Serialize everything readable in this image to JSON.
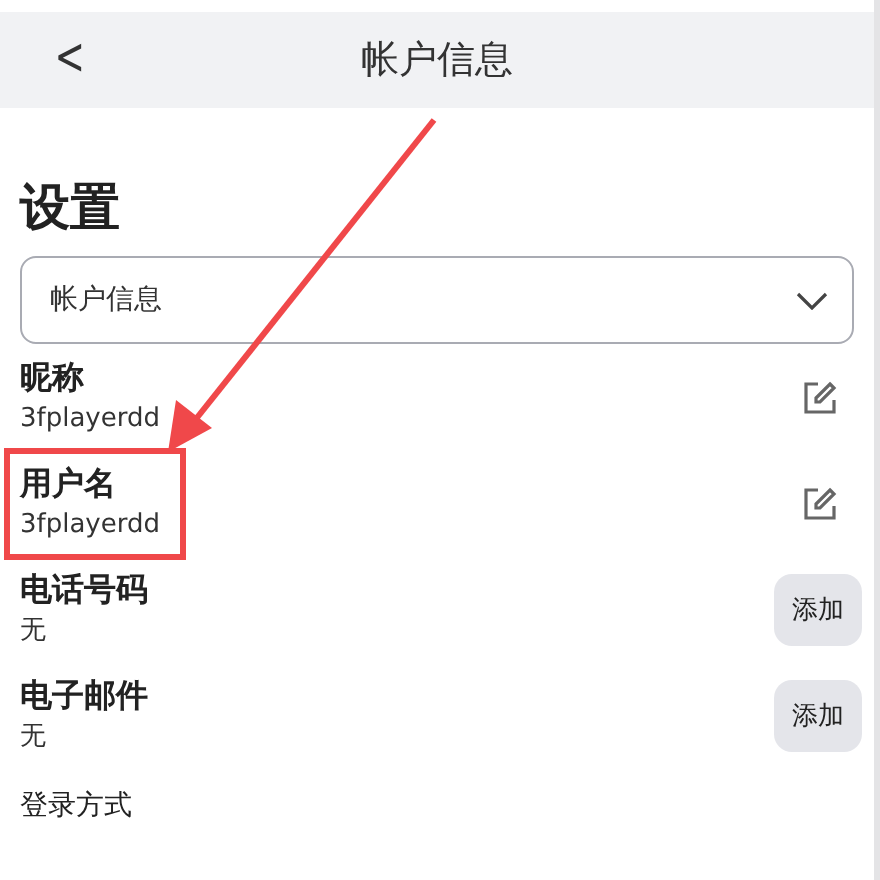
{
  "header": {
    "back": "<",
    "title": "帐户信息"
  },
  "section_title": "设置",
  "dropdown": {
    "value": "帐户信息"
  },
  "fields": [
    {
      "label": "昵称",
      "value": "3fplayerdd",
      "kind": "edit",
      "highlighted": false
    },
    {
      "label": "用户名",
      "value": "3fplayerdd",
      "kind": "edit",
      "highlighted": true
    },
    {
      "label": "电话号码",
      "value": "无",
      "kind": "add",
      "action": "添加",
      "highlighted": false
    },
    {
      "label": "电子邮件",
      "value": "无",
      "kind": "add",
      "action": "添加",
      "highlighted": false
    }
  ],
  "footer_label": "登录方式"
}
